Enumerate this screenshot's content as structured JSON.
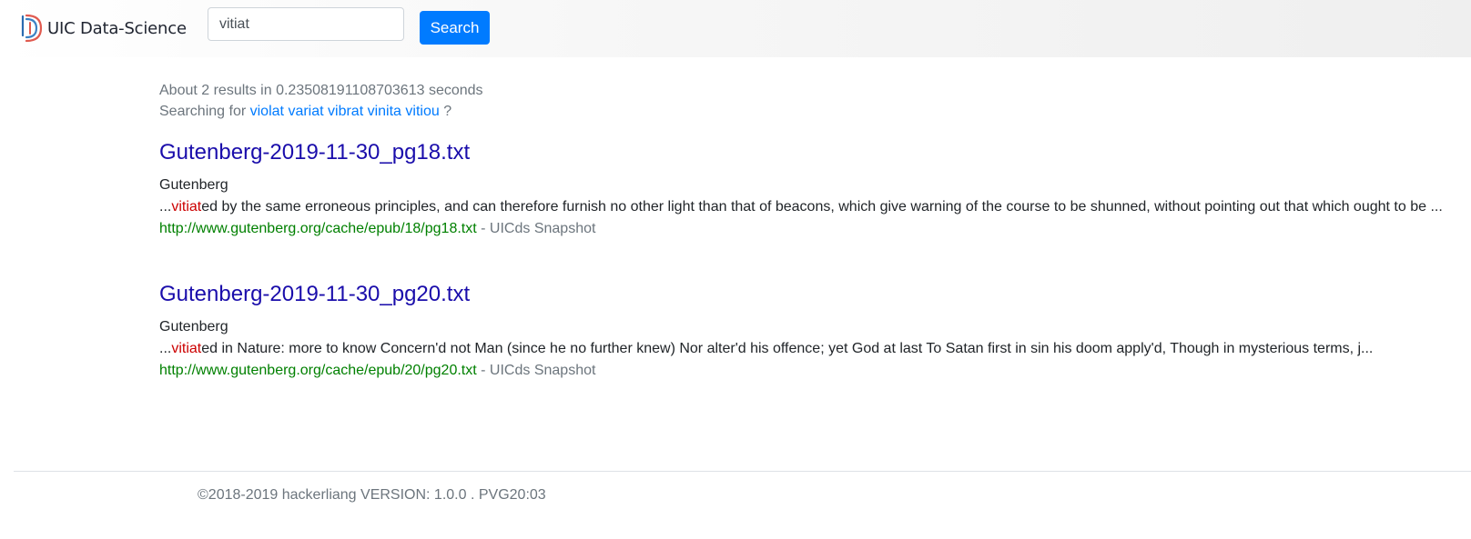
{
  "header": {
    "logo_text": "UIC Data-Science",
    "search": {
      "value": "vitiat",
      "placeholder": ""
    },
    "search_button_label": "Search"
  },
  "results_info": {
    "stats_text": "About 2 results in 0.23508191108703613 seconds",
    "suggest_prefix": "Searching for",
    "suggestions": [
      "violat",
      "variat",
      "vibrat",
      "vinita",
      "vitiou"
    ],
    "suggest_suffix": "?"
  },
  "results": [
    {
      "title": "Gutenberg-2019-11-30_pg18.txt",
      "source": "Gutenberg",
      "snippet_prefix": "...",
      "snippet_highlight": "vitiat",
      "snippet_rest": "ed by the same erroneous principles, and can therefore furnish no other light than that of beacons, which give warning of the course to be shunned, without pointing out that which ought to be ...",
      "url": "http://www.gutenberg.org/cache/epub/18/pg18.txt",
      "separator": "-",
      "snapshot_label": "UICds Snapshot"
    },
    {
      "title": "Gutenberg-2019-11-30_pg20.txt",
      "source": "Gutenberg",
      "snippet_prefix": "...",
      "snippet_highlight": "vitiat",
      "snippet_rest": "ed in Nature: more to know Concern'd not Man (since he no further knew) Nor alter'd his offence; yet God at last To Satan first in sin his doom apply'd, Though in mysterious terms, j...",
      "url": "http://www.gutenberg.org/cache/epub/20/pg20.txt",
      "separator": "-",
      "snapshot_label": "UICds Snapshot"
    }
  ],
  "footer": {
    "text": "©2018-2019 hackerliang VERSION: 1.0.0 . PVG20:03"
  },
  "colors": {
    "primary_button": "#007bff",
    "title_link": "#1a0dab",
    "url_green": "#008000",
    "highlight_red": "#cc0000",
    "muted": "#6c757d"
  }
}
